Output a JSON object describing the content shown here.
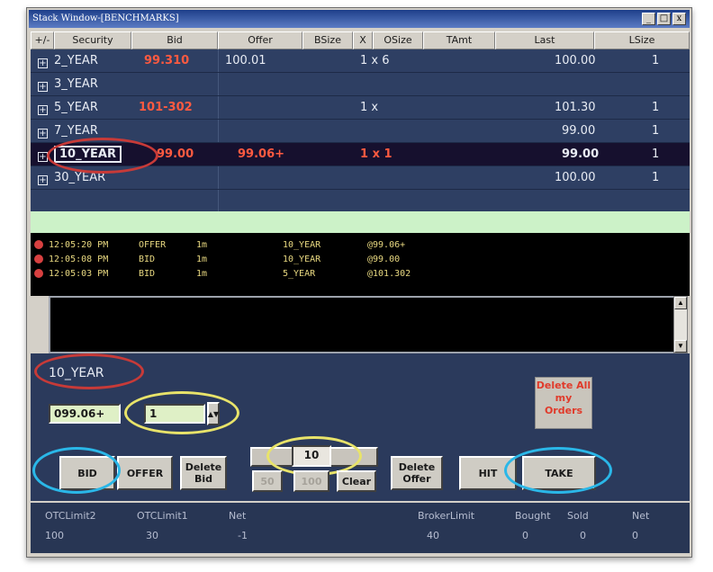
{
  "window": {
    "title": "Stack Window-[BENCHMARKS]",
    "min": "_",
    "max": "□",
    "close": "x"
  },
  "columns": [
    "+/-",
    "Security",
    "Bid",
    "Offer",
    "BSize",
    "X",
    "OSize",
    "TAmt",
    "Last",
    "LSize"
  ],
  "rows": [
    {
      "security": "2_YEAR",
      "bid": "99.310",
      "offer": "100.01",
      "size": "1 x 6",
      "last": "100.00",
      "lsize": "1"
    },
    {
      "security": "3_YEAR",
      "bid": "",
      "offer": "",
      "size": "",
      "last": "",
      "lsize": ""
    },
    {
      "security": "5_YEAR",
      "bid": "101-302",
      "offer": "",
      "size": "1 x",
      "last": "101.30",
      "lsize": "1"
    },
    {
      "security": "7_YEAR",
      "bid": "",
      "offer": "",
      "size": "",
      "last": "99.00",
      "lsize": "1"
    },
    {
      "security": "10_YEAR",
      "bid": "99.00",
      "offer": "99.06+",
      "size": "1 x 1",
      "last": "99.00",
      "lsize": "1"
    },
    {
      "security": "30_YEAR",
      "bid": "",
      "offer": "",
      "size": "",
      "last": "100.00",
      "lsize": "1"
    }
  ],
  "log": [
    {
      "time": "12:05:20 PM",
      "side": "OFFER",
      "qty": "1m",
      "sec": "10_YEAR",
      "price": "@99.06+"
    },
    {
      "time": "12:05:08 PM",
      "side": "BID",
      "qty": "1m",
      "sec": "10_YEAR",
      "price": "@99.00"
    },
    {
      "time": "12:05:03 PM",
      "side": "BID",
      "qty": "1m",
      "sec": "5_YEAR",
      "price": "@101.302"
    }
  ],
  "entry": {
    "symbol": "10_YEAR",
    "price": "099.06+",
    "qty": "1",
    "delete_all": "Delete All my Orders"
  },
  "buttons": {
    "bid": "BID",
    "offer": "OFFER",
    "delete_bid": "Delete Bid",
    "size": "10",
    "b50": "50",
    "b100": "100",
    "clear": "Clear",
    "delete_offer": "Delete Offer",
    "hit": "HIT",
    "take": "TAKE"
  },
  "status": {
    "labels": [
      "OTCLimit2",
      "OTCLimit1",
      "Net",
      "BrokerLimit",
      "Bought",
      "Sold",
      "Net"
    ],
    "values": [
      "100",
      "30",
      "-1",
      "40",
      "0",
      "0",
      "0"
    ]
  }
}
